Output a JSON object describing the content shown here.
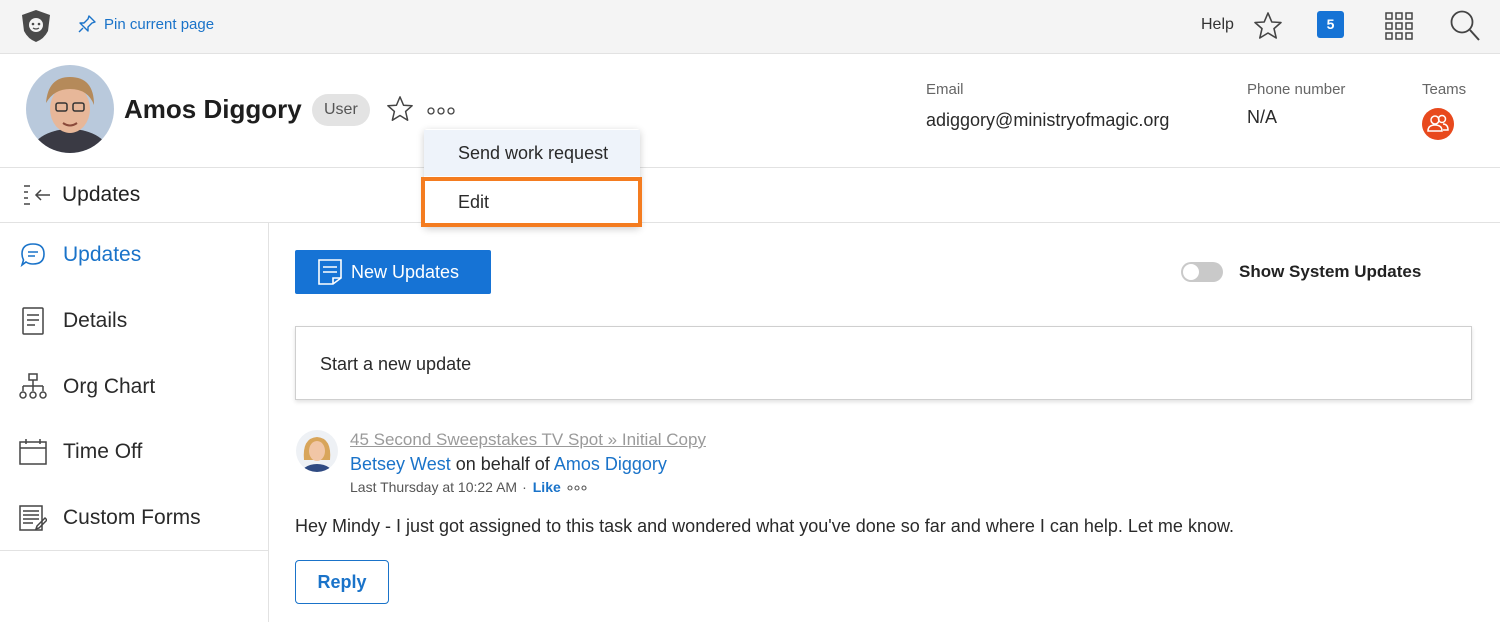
{
  "topbar": {
    "logo_icon": "lion-shield-icon",
    "pin_label": "Pin current page",
    "help_label": "Help",
    "notification_count": "5",
    "accent": "#1673d5"
  },
  "profile": {
    "name": "Amos Diggory",
    "role": "User",
    "email_label": "Email",
    "email": "adiggory@ministryofmagic.org",
    "phone_label": "Phone number",
    "phone": "N/A",
    "teams_label": "Teams",
    "teams_color": "#e8491d"
  },
  "dropdown": {
    "items": [
      {
        "label": "Send work request"
      },
      {
        "label": "Edit"
      }
    ],
    "highlight_color": "#f47c20"
  },
  "subheader": {
    "title": "Updates"
  },
  "sidebar": {
    "items": [
      {
        "label": "Updates",
        "icon": "chat-bubble-icon",
        "active": true
      },
      {
        "label": "Details",
        "icon": "document-icon"
      },
      {
        "label": "Org Chart",
        "icon": "org-chart-icon"
      },
      {
        "label": "Time Off",
        "icon": "calendar-icon"
      },
      {
        "label": "Custom Forms",
        "icon": "forms-icon"
      }
    ]
  },
  "main": {
    "new_updates_label": "New Updates",
    "toggle_label": "Show System Updates",
    "toggle_on": false,
    "compose_placeholder": "Start a new update",
    "update": {
      "link": "45 Second Sweepstakes TV Spot » Initial Copy",
      "author": "Betsey West",
      "behalf_text": "on behalf of",
      "behalf_of": "Amos Diggory",
      "time": "Last Thursday at 10:22 AM",
      "separator": "·",
      "like_label": "Like",
      "body": "Hey Mindy - I just got assigned to this task and wondered what you've done so far and where I can help. Let me know."
    },
    "reply_label": "Reply"
  }
}
